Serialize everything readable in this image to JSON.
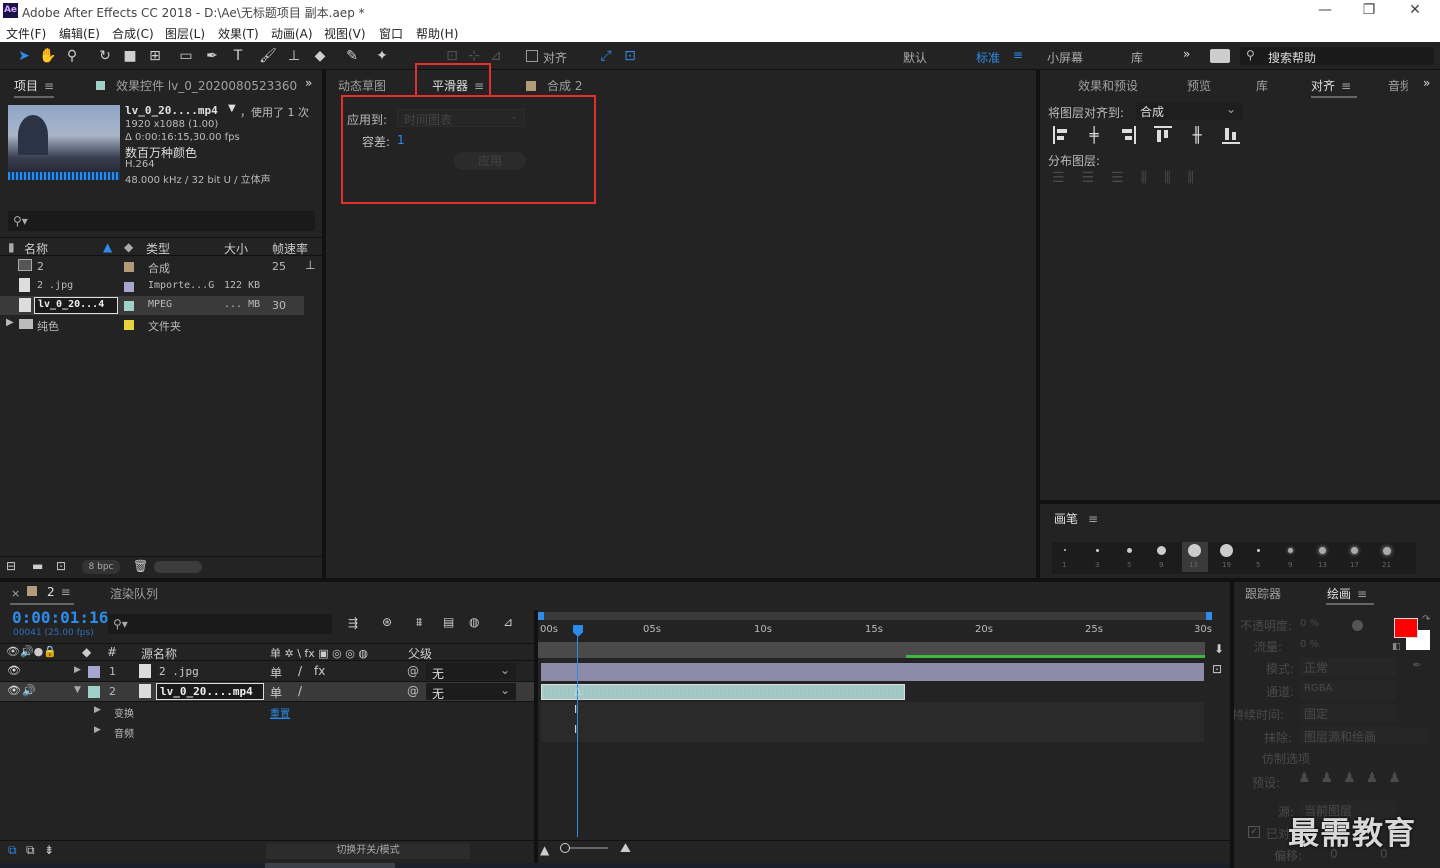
{
  "app": {
    "title": "Adobe After Effects CC 2018 - D:\\Ae\\无标题项目 副本.aep *",
    "logo": "Ae"
  },
  "menu": [
    "文件(F)",
    "编辑(E)",
    "合成(C)",
    "图层(L)",
    "效果(T)",
    "动画(A)",
    "视图(V)",
    "窗口",
    "帮助(H)"
  ],
  "toolbar": {
    "snap_label": "对齐",
    "workspaces": [
      "默认",
      "标准",
      "小屏幕",
      "库"
    ],
    "active_workspace": "标准",
    "search_placeholder": "搜索帮助"
  },
  "project_panel": {
    "tab_project": "项目",
    "tab_effect_controls": "效果控件 lv_0_2020080523360",
    "asset": {
      "name": "lv_0_20....mp4",
      "used": "，使用了 1 次",
      "dims": "1920 x1088 (1.00)",
      "duration": "Δ 0:00:16:15,30.00 fps",
      "colors": "数百万种颜色",
      "codec": "H.264",
      "audio": "48.000 kHz / 32 bit U / 立体声"
    },
    "search_placeholder": "",
    "columns": {
      "name": "名称",
      "type": "类型",
      "size": "大小",
      "fps": "帧速率"
    },
    "items": [
      {
        "name": "2",
        "type": "合成",
        "size": "",
        "fps": "25",
        "color": "#b39a78",
        "icon": "comp-icon"
      },
      {
        "name": "2 .jpg",
        "type": "Importe...G",
        "size": "122 KB",
        "fps": "",
        "color": "#a6a6cf",
        "icon": "image-file-icon"
      },
      {
        "name": "lv_0_20...4",
        "type": "MPEG",
        "size": "... MB",
        "fps": "30",
        "color": "#9fd0c9",
        "icon": "video-file-icon"
      },
      {
        "name": "纯色",
        "type": "文件夹",
        "size": "",
        "fps": "",
        "color": "#e6d43c",
        "icon": "folder-icon"
      }
    ],
    "bpc": "8 bpc"
  },
  "center_panel": {
    "tabs": [
      "动态草图",
      "平滑器",
      "合成 2"
    ],
    "active_tab": "平滑器",
    "apply_to_label": "应用到:",
    "apply_to_value": "时间图表",
    "tolerance_label": "容差:",
    "tolerance_value": "1",
    "apply_button": "应用"
  },
  "right_panel": {
    "tabs": [
      "效果和预设",
      "预览",
      "库",
      "对齐",
      "音频"
    ],
    "active_tab": "对齐",
    "align_to_label": "将图层对齐到:",
    "align_to_value": "合成",
    "distribute_label": "分布图层:",
    "brush_title": "画笔",
    "brush_sizes": [
      "1",
      "3",
      "5",
      "9",
      "13",
      "19",
      "5",
      "9",
      "13",
      "17",
      "21"
    ]
  },
  "timeline": {
    "tab_comp": "2",
    "tab_render": "渲染队列",
    "timecode": "0:00:01:16",
    "frame_info": "00041 (25.00 fps)",
    "columns": {
      "num": "#",
      "source": "源名称",
      "switches": "单 ✲ \\ fx ▣ ◎ ◎ ◍",
      "parent": "父级"
    },
    "layers": [
      {
        "num": "1",
        "name": "2 .jpg",
        "color": "#a6a6cf",
        "parent": "无",
        "expanded": false
      },
      {
        "num": "2",
        "name": "lv_0_20....mp4",
        "color": "#9fd0c9",
        "parent": "无",
        "expanded": true
      }
    ],
    "props": [
      {
        "name": "变换",
        "value": "重置"
      },
      {
        "name": "音频",
        "value": ""
      }
    ],
    "ruler": [
      "00s",
      "05s",
      "10s",
      "15s",
      "20s",
      "25s",
      "30s"
    ],
    "toggle_label": "切换开关/模式"
  },
  "paint_panel": {
    "tab_tracker": "跟踪器",
    "tab_paint": "绘画",
    "opacity_label": "不透明度:",
    "opacity_value": "0 %",
    "flow_label": "流量:",
    "flow_value": "0 %",
    "mode_label": "模式:",
    "mode_value": "正常",
    "channel_label": "通道:",
    "channel_value": "RGBA",
    "duration_label": "持续时间:",
    "duration_value": "固定",
    "erase_label": "抹除:",
    "erase_value": "图层源和绘画",
    "clone_label": "仿制选项",
    "preset_label": "预设:",
    "source_label": "源:",
    "source_value": "当前图层",
    "aligned_label": "已对齐",
    "offset_label": "偏移:",
    "offset_x": "0",
    "offset_y": "0",
    "fg_color": "#ff0000",
    "bg_color": "#ffffff"
  },
  "watermark": "最需教育"
}
